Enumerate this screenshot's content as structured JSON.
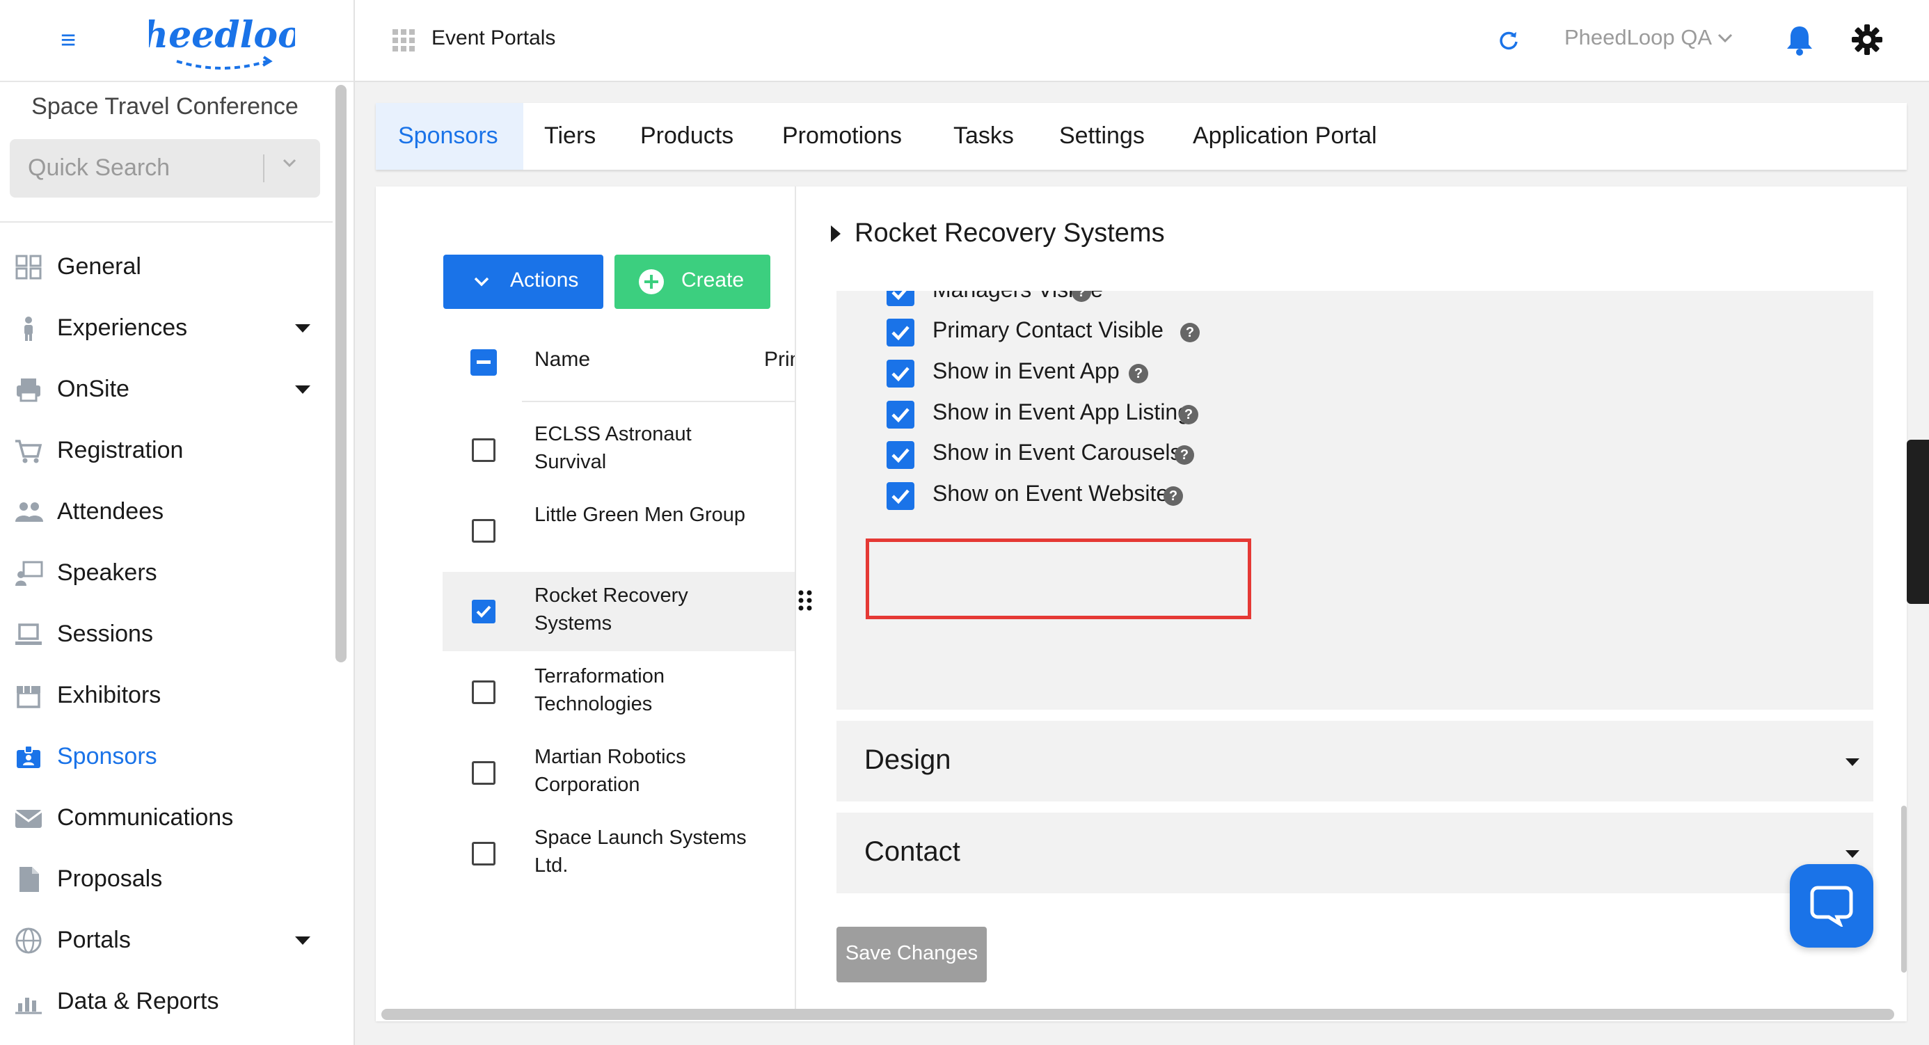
{
  "topbar": {
    "title": "Event Portals",
    "org_name": "PheedLoop QA"
  },
  "logo": {
    "text": "pheedloop"
  },
  "sidebar": {
    "event_name": "Space Travel Conference",
    "search_placeholder": "Quick Search",
    "items": [
      {
        "label": "General",
        "icon": "grid-icon",
        "caret": false
      },
      {
        "label": "Experiences",
        "icon": "person-icon",
        "caret": true
      },
      {
        "label": "OnSite",
        "icon": "printer-icon",
        "caret": true
      },
      {
        "label": "Registration",
        "icon": "cart-icon",
        "caret": false
      },
      {
        "label": "Attendees",
        "icon": "people-icon",
        "caret": false
      },
      {
        "label": "Speakers",
        "icon": "presenter-icon",
        "caret": false
      },
      {
        "label": "Sessions",
        "icon": "laptop-icon",
        "caret": false
      },
      {
        "label": "Exhibitors",
        "icon": "storefront-icon",
        "caret": false
      },
      {
        "label": "Sponsors",
        "icon": "badge-icon",
        "caret": false,
        "active": true
      },
      {
        "label": "Communications",
        "icon": "mail-icon",
        "caret": false
      },
      {
        "label": "Proposals",
        "icon": "document-icon",
        "caret": false
      },
      {
        "label": "Portals",
        "icon": "globe-icon",
        "caret": true
      },
      {
        "label": "Data & Reports",
        "icon": "chart-icon",
        "caret": false
      }
    ]
  },
  "tabs": [
    {
      "label": "Sponsors",
      "active": true
    },
    {
      "label": "Tiers"
    },
    {
      "label": "Products"
    },
    {
      "label": "Promotions"
    },
    {
      "label": "Tasks"
    },
    {
      "label": "Settings"
    },
    {
      "label": "Application Portal"
    }
  ],
  "list": {
    "actions_label": "Actions",
    "create_label": "Create",
    "columns": {
      "name": "Name",
      "primary": "Prim"
    },
    "rows": [
      {
        "name": "ECLSS Astronaut Survival",
        "checked": false
      },
      {
        "name": "Little Green Men Group",
        "checked": false
      },
      {
        "name": "Rocket Recovery Systems",
        "checked": true
      },
      {
        "name": "Terraformation Technologies",
        "checked": false
      },
      {
        "name": "Martian Robotics Corporation",
        "checked": false
      },
      {
        "name": "Space Launch Systems Ltd.",
        "checked": false
      }
    ]
  },
  "panel": {
    "title": "Rocket Recovery Systems",
    "settings": [
      {
        "label": "Managers Visible",
        "checked": true
      },
      {
        "label": "Primary Contact Visible",
        "checked": true
      },
      {
        "label": "Show in Event App",
        "checked": true
      },
      {
        "label": "Show in Event App Listing",
        "checked": true
      },
      {
        "label": "Show in Event Carousels",
        "checked": true,
        "highlighted": true
      },
      {
        "label": "Show on Event Website",
        "checked": true
      }
    ],
    "sections": [
      {
        "label": "Design"
      },
      {
        "label": "Contact"
      }
    ],
    "save_label": "Save Changes"
  },
  "colors": {
    "accent": "#1a73e8",
    "create": "#3ccf7f",
    "highlight": "#e53935",
    "save_disabled": "#9e9e9e"
  }
}
